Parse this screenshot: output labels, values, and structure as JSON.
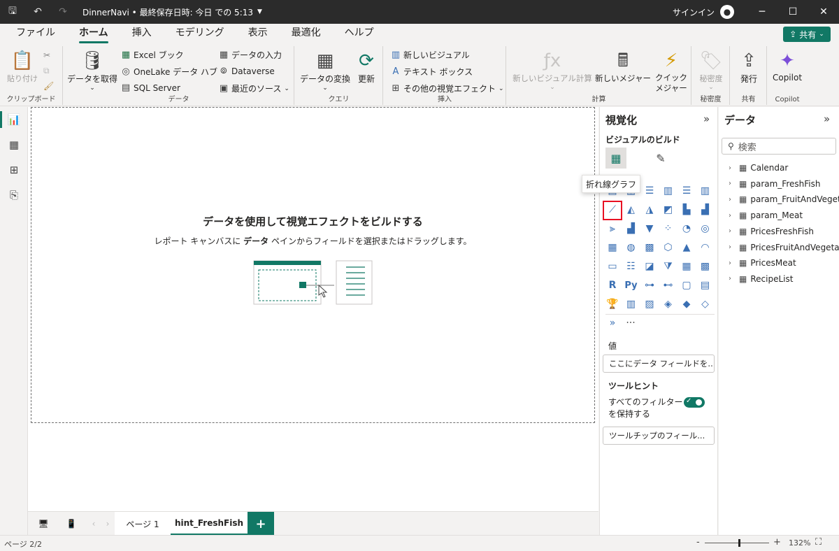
{
  "titlebar": {
    "title": "DinnerNavi • 最終保存日時: 今日 での 5:13",
    "signin": "サインイン"
  },
  "menu": {
    "tabs": [
      {
        "label": "ファイル"
      },
      {
        "label": "ホーム"
      },
      {
        "label": "挿入"
      },
      {
        "label": "モデリング"
      },
      {
        "label": "表示"
      },
      {
        "label": "最適化"
      },
      {
        "label": "ヘルプ"
      }
    ],
    "share": "共有"
  },
  "ribbon": {
    "clipboard": {
      "label": "クリップボード",
      "paste": "貼り付け"
    },
    "data": {
      "label": "データ",
      "get_data": "データを取得",
      "excel": "Excel ブック",
      "onelake": "OneLake データ ハブ",
      "sql": "SQL Server",
      "enter_data": "データの入力",
      "dataverse": "Dataverse",
      "recent": "最近のソース"
    },
    "query": {
      "label": "クエリ",
      "transform": "データの変換",
      "refresh": "更新"
    },
    "insert": {
      "label": "挿入",
      "new_visual": "新しいビジュアル",
      "textbox": "テキスト ボックス",
      "more_visuals": "その他の視覚エフェクト"
    },
    "calc": {
      "label": "計算",
      "new_visual_calc": "新しいビジュアル計算",
      "new_measure": "新しいメジャー",
      "quick_measure": "クイック メジャー"
    },
    "sensitivity": {
      "label": "秘密度",
      "btn": "秘密度"
    },
    "share": {
      "label": "共有",
      "publish": "発行"
    },
    "copilot": {
      "label": "Copilot",
      "btn": "Copilot"
    }
  },
  "canvas": {
    "title": "データを使用して視覚エフェクトをビルドする",
    "sub_pre": "レポート キャンバスに ",
    "sub_bold": "データ",
    "sub_post": " ペインからフィールドを選択またはドラッグします。"
  },
  "pages": {
    "tabs": [
      {
        "label": "ページ 1"
      },
      {
        "label": "hint_FreshFish"
      }
    ]
  },
  "status": {
    "page": "ページ 2/2",
    "zoom": "132%"
  },
  "viz": {
    "title": "視覚化",
    "build": "ビジュアルのビルド",
    "tooltip": "折れ線グラフ",
    "values_label": "値",
    "values_placeholder": "ここにデータ フィールドを...",
    "tooltips_label": "ツールヒント",
    "keep_filters": "すべてのフィルター",
    "keep_filters2": "を保持する",
    "tooltip_placeholder": "ツールチップのフィール...",
    "more": "···"
  },
  "data": {
    "title": "データ",
    "search_placeholder": "検索",
    "fields": [
      {
        "name": "Calendar"
      },
      {
        "name": "param_FreshFish"
      },
      {
        "name": "param_FruitAndVegeta..."
      },
      {
        "name": "param_Meat"
      },
      {
        "name": "PricesFreshFish"
      },
      {
        "name": "PricesFruitAndVegeta..."
      },
      {
        "name": "PricesMeat"
      },
      {
        "name": "RecipeList"
      }
    ]
  }
}
